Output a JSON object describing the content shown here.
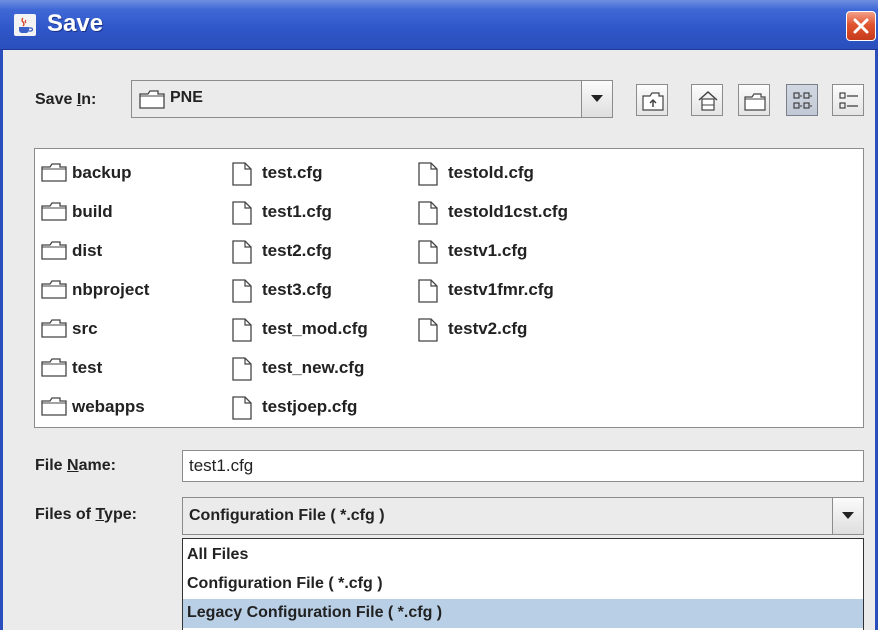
{
  "window": {
    "title": "Save",
    "app_icon": "java-cup-icon",
    "close_icon": "close-icon"
  },
  "save_in": {
    "label_before": "Save ",
    "label_mnemonic": "I",
    "label_after": "n:",
    "value": "PNE"
  },
  "toolbar": {
    "buttons": [
      {
        "name": "up-one-level-button",
        "icon": "up-folder-icon"
      },
      {
        "name": "home-button",
        "icon": "home-icon"
      },
      {
        "name": "new-folder-button",
        "icon": "new-folder-icon"
      },
      {
        "name": "list-view-button",
        "icon": "list-view-icon",
        "selected": true
      },
      {
        "name": "details-view-button",
        "icon": "details-view-icon"
      }
    ]
  },
  "files": {
    "column1": [
      "backup",
      "build",
      "dist",
      "nbproject",
      "src",
      "test",
      "webapps"
    ],
    "column2": [
      "test.cfg",
      "test1.cfg",
      "test2.cfg",
      "test3.cfg",
      "test_mod.cfg",
      "test_new.cfg",
      "testjoep.cfg"
    ],
    "column3": [
      "testold.cfg",
      "testold1cst.cfg",
      "testv1.cfg",
      "testv1fmr.cfg",
      "testv2.cfg"
    ]
  },
  "file_name": {
    "label_before": "File ",
    "label_mnemonic": "N",
    "label_after": "ame:",
    "value": "test1.cfg"
  },
  "files_of_type": {
    "label_before": "Files of ",
    "label_mnemonic": "T",
    "label_after": "ype:",
    "value": "Configuration File ( *.cfg )",
    "options": [
      "All Files",
      "Configuration File ( *.cfg )",
      "Legacy Configuration File  ( *.cfg )"
    ],
    "highlighted_index": 2
  },
  "colors": {
    "title_bar": "#2f56c8",
    "dialog_bg": "#ebebeb",
    "selection": "#b8cfe5",
    "close_button": "#e0542f"
  }
}
